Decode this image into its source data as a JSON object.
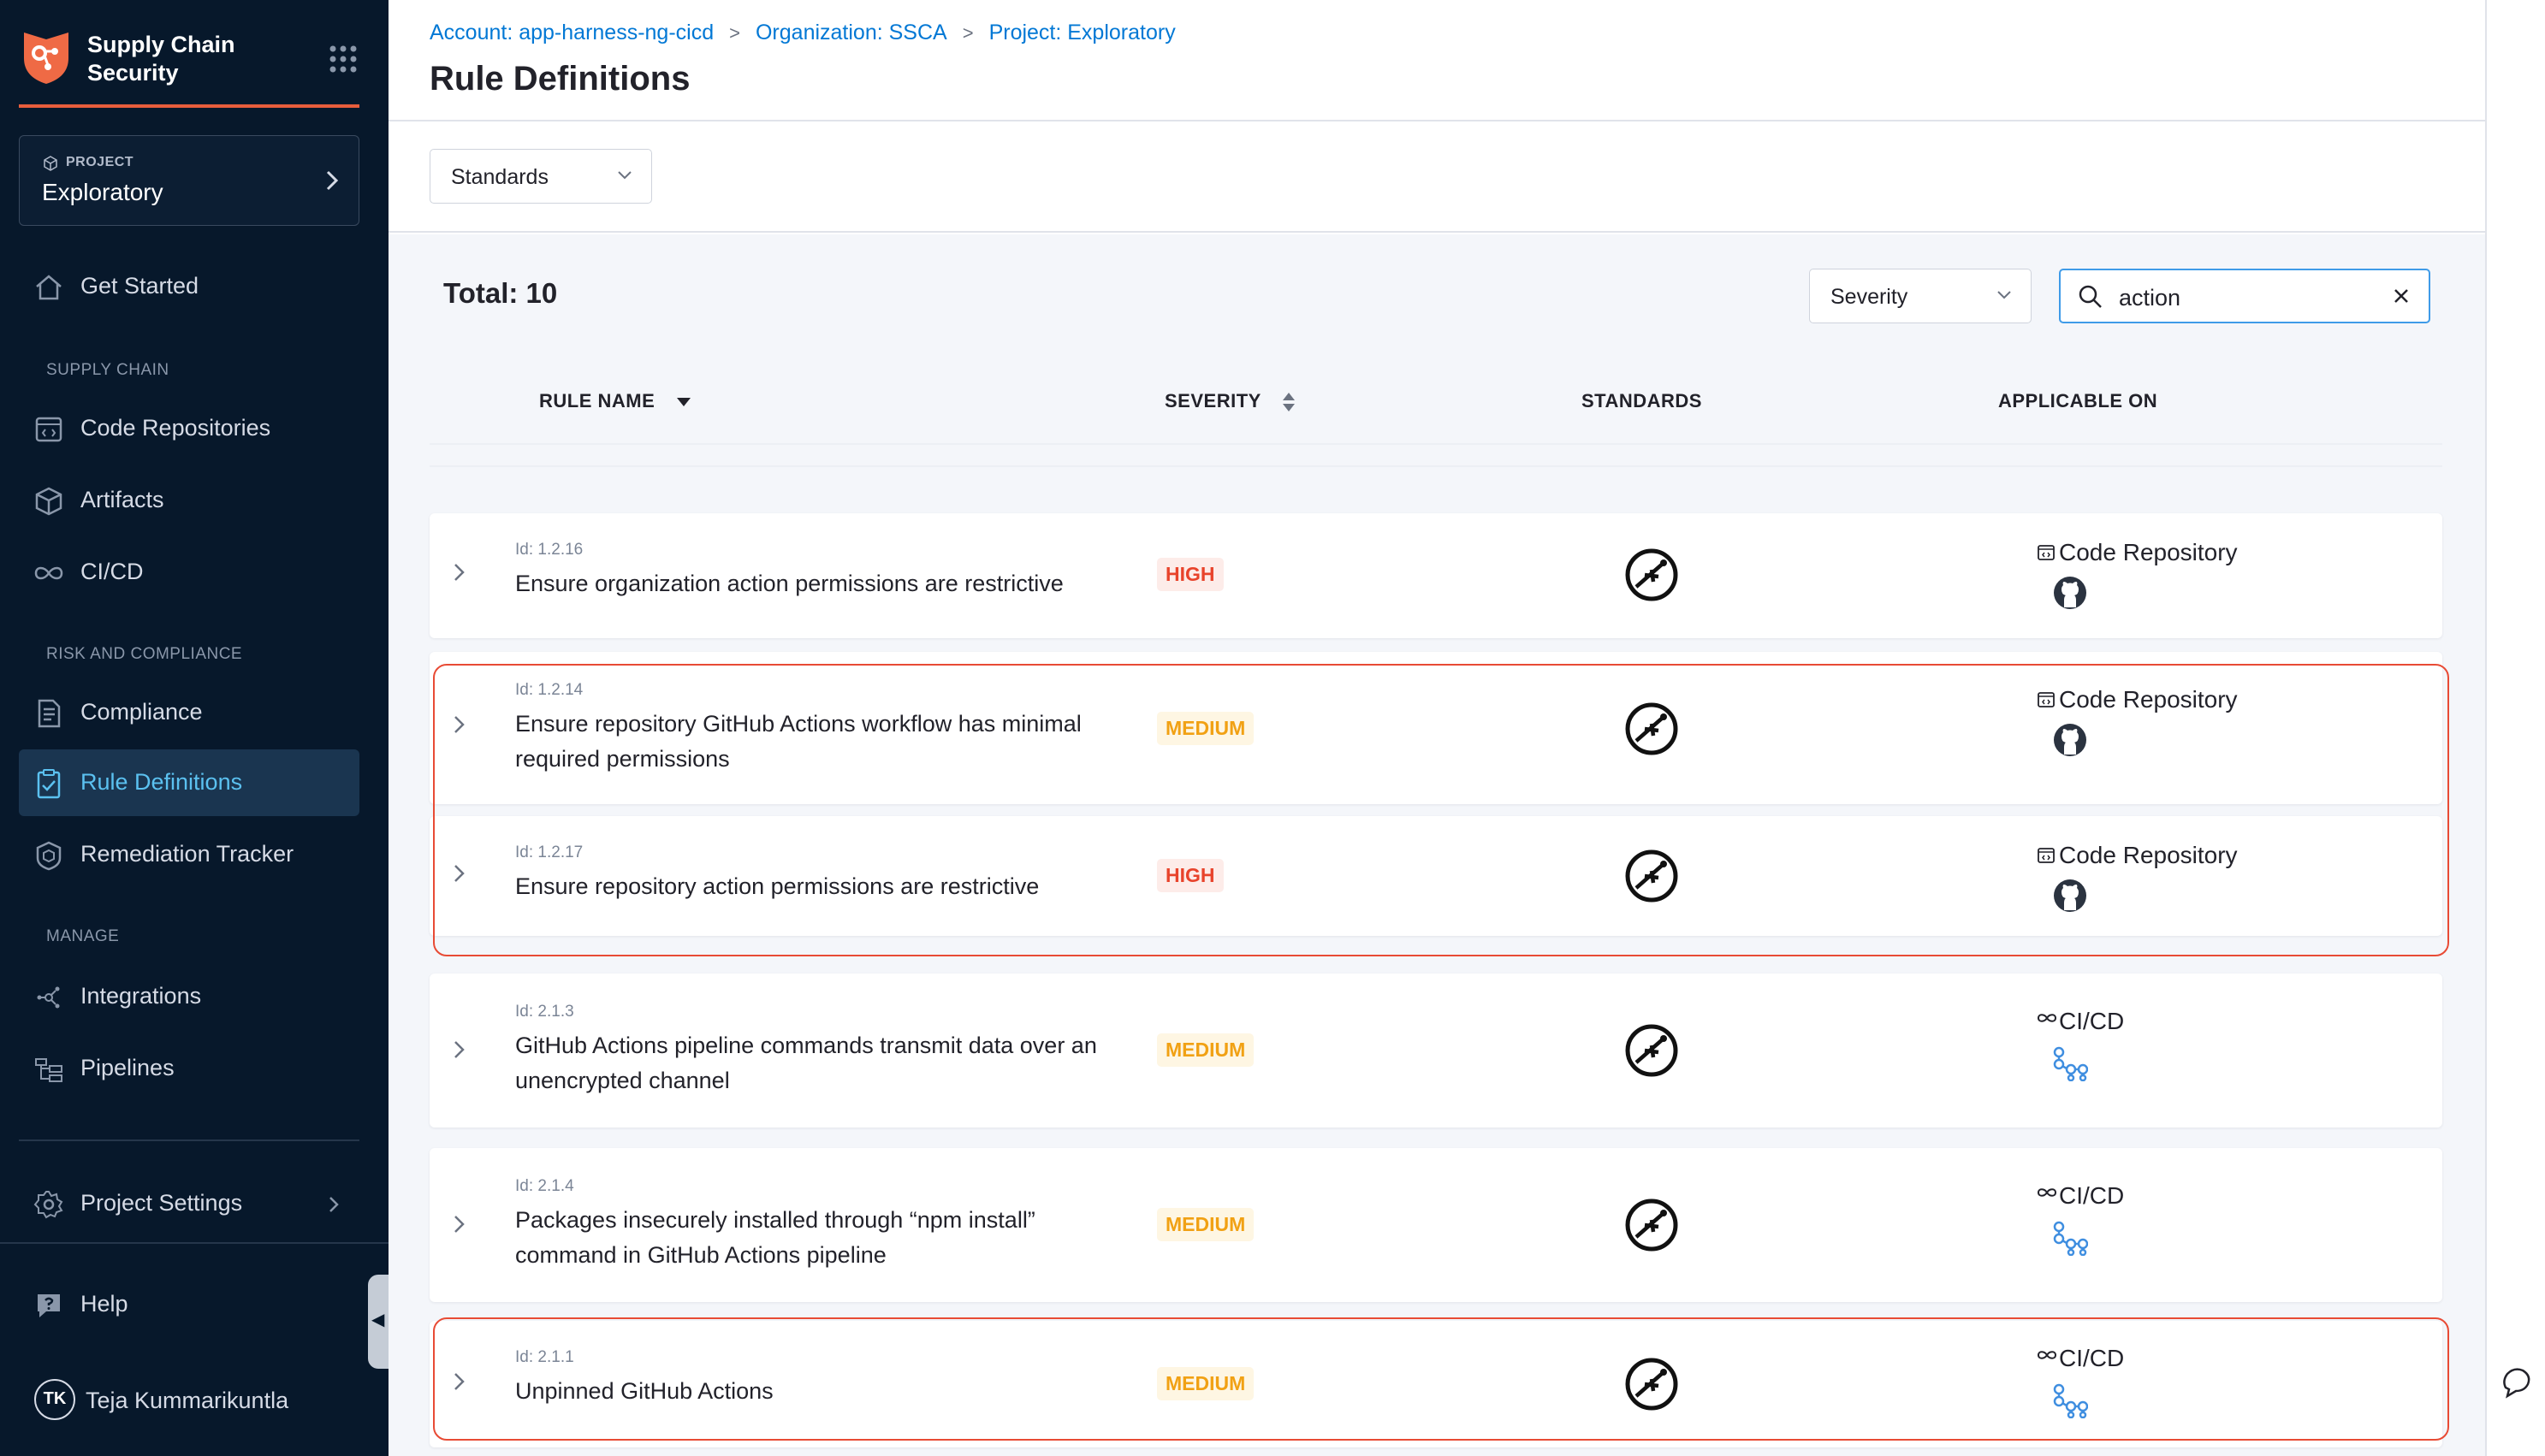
{
  "sidebar": {
    "brand_title": "Supply Chain Security",
    "project_kicker": "PROJECT",
    "project_name": "Exploratory",
    "items": {
      "get_started": "Get Started",
      "code_repositories": "Code Repositories",
      "artifacts": "Artifacts",
      "cicd": "CI/CD",
      "compliance": "Compliance",
      "rule_definitions": "Rule Definitions",
      "remediation_tracker": "Remediation Tracker",
      "integrations": "Integrations",
      "pipelines": "Pipelines",
      "project_settings": "Project Settings",
      "help": "Help"
    },
    "sections": {
      "supply_chain": "SUPPLY CHAIN",
      "risk_and_compliance": "RISK AND COMPLIANCE",
      "manage": "MANAGE"
    },
    "user": {
      "initials": "TK",
      "name": "Teja Kummarikuntla"
    }
  },
  "header": {
    "breadcrumbs": [
      "Account: app-harness-ng-cicd",
      "Organization: SSCA",
      "Project: Exploratory"
    ],
    "title": "Rule Definitions"
  },
  "filters": {
    "standards_label": "Standards",
    "severity_label": "Severity",
    "search_value": "action"
  },
  "table": {
    "total_label": "Total: 10",
    "columns": {
      "rule_name": "RULE NAME",
      "severity": "SEVERITY",
      "standards": "STANDARDS",
      "applicable_on": "APPLICABLE ON"
    },
    "rows": [
      {
        "id": "Id: 1.2.16",
        "name": "Ensure organization action permissions are restrictive",
        "severity": "HIGH",
        "applicable": "Code Repository",
        "applicable_icon": "github-icon"
      },
      {
        "id": "Id: 1.2.14",
        "name": "Ensure repository GitHub Actions workflow has minimal required permissions",
        "severity": "MEDIUM",
        "applicable": "Code Repository",
        "applicable_icon": "github-icon"
      },
      {
        "id": "Id: 1.2.17",
        "name": "Ensure repository action permissions are restrictive",
        "severity": "HIGH",
        "applicable": "Code Repository",
        "applicable_icon": "github-icon"
      },
      {
        "id": "Id: 2.1.3",
        "name": "GitHub Actions pipeline commands transmit data over an unencrypted channel",
        "severity": "MEDIUM",
        "applicable": "CI/CD",
        "applicable_icon": "pipeline-icon"
      },
      {
        "id": "Id: 2.1.4",
        "name": "Packages insecurely installed through “npm install” command in GitHub Actions pipeline",
        "severity": "MEDIUM",
        "applicable": "CI/CD",
        "applicable_icon": "pipeline-icon"
      },
      {
        "id": "Id: 2.1.1",
        "name": "Unpinned GitHub Actions",
        "severity": "MEDIUM",
        "applicable": "CI/CD",
        "applicable_icon": "pipeline-icon"
      }
    ]
  },
  "colors": {
    "sidebar_bg": "#07182b",
    "accent": "#0278d5",
    "highlight_frame": "#e84b35",
    "high": "#e8432b",
    "medium": "#f1a114"
  }
}
